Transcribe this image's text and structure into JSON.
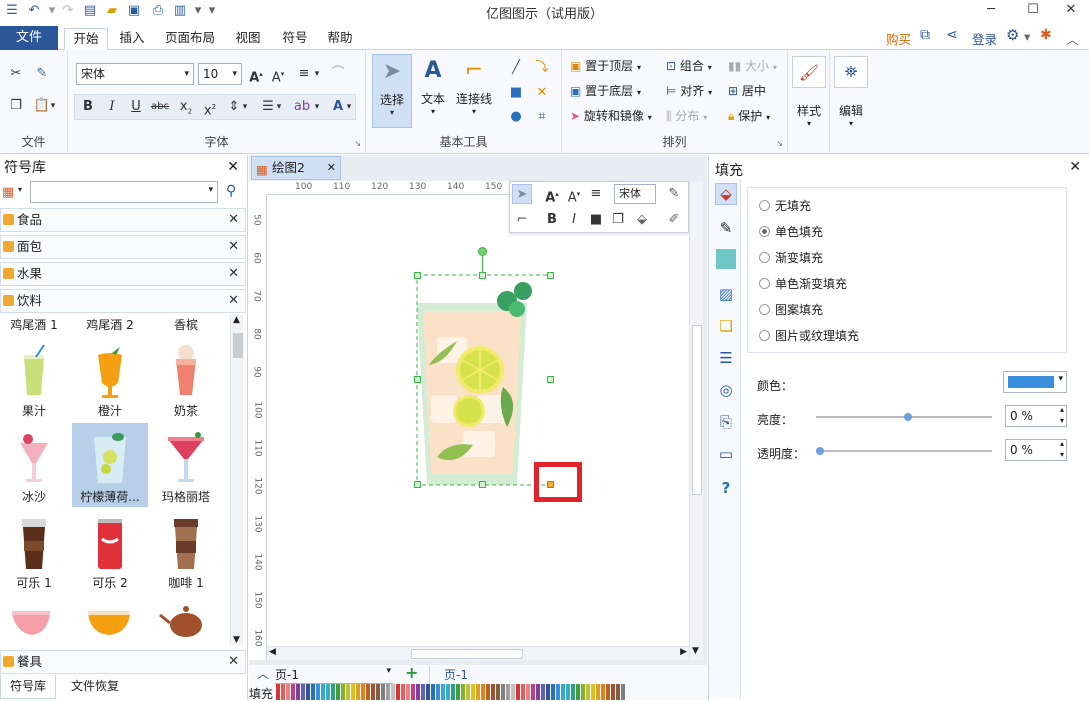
{
  "app_title": "亿图图示（试用版）",
  "menu": {
    "file": "文件",
    "tabs": [
      "开始",
      "插入",
      "页面布局",
      "视图",
      "符号",
      "帮助"
    ],
    "buy": "购买",
    "login": "登录"
  },
  "ribbon": {
    "file_group_label": "文件",
    "font_group_label": "字体",
    "font_name": "宋体",
    "font_size": "10",
    "tools_group_label": "基本工具",
    "select_label": "选择",
    "text_label": "文本",
    "connector_label": "连接线",
    "arrange_group_label": "排列",
    "bring_front": "置于顶层",
    "send_back": "置于底层",
    "rotate_mirror": "旋转和镜像",
    "group": "组合",
    "align": "对齐",
    "distribute": "分布",
    "size": "大小",
    "center": "居中",
    "protect": "保护",
    "style_label": "样式",
    "edit_label": "编辑"
  },
  "symbol_library": {
    "title": "符号库",
    "categories": [
      "食品",
      "面包",
      "水果",
      "饮料"
    ],
    "items": [
      {
        "label": "鸡尾酒 1"
      },
      {
        "label": "鸡尾酒 2"
      },
      {
        "label": "香槟"
      },
      {
        "label": "果汁"
      },
      {
        "label": "橙汁"
      },
      {
        "label": "奶茶"
      },
      {
        "label": "冰沙"
      },
      {
        "label": "柠檬薄荷..."
      },
      {
        "label": "玛格丽塔"
      },
      {
        "label": "可乐 1"
      },
      {
        "label": "可乐 2"
      },
      {
        "label": "咖啡 1"
      }
    ],
    "bottom_category": "餐具",
    "bottom_tabs": [
      "符号库",
      "文件恢复"
    ]
  },
  "canvas": {
    "doc_tab": "绘图2",
    "ruler_h": [
      "100",
      "110",
      "120",
      "130",
      "140",
      "150"
    ],
    "ruler_v": [
      "50",
      "60",
      "70",
      "80",
      "90",
      "100",
      "110",
      "120",
      "130",
      "140",
      "150",
      "160"
    ],
    "float_font": "宋体",
    "page_select": "页-1",
    "page_tab": "页-1",
    "fill_label": "填充"
  },
  "fill_panel": {
    "title": "填充",
    "options": [
      "无填充",
      "单色填充",
      "渐变填充",
      "单色渐变填充",
      "图案填充",
      "图片或纹理填充"
    ],
    "selected_option": "单色填充",
    "color_label": "颜色：",
    "color_value": "#3a8fdc",
    "brightness_label": "亮度：",
    "brightness_value": "0 %",
    "transparency_label": "透明度：",
    "transparency_value": "0 %"
  },
  "colors": {
    "accent": "#2b579a",
    "highlight_box": "#e0242a"
  }
}
